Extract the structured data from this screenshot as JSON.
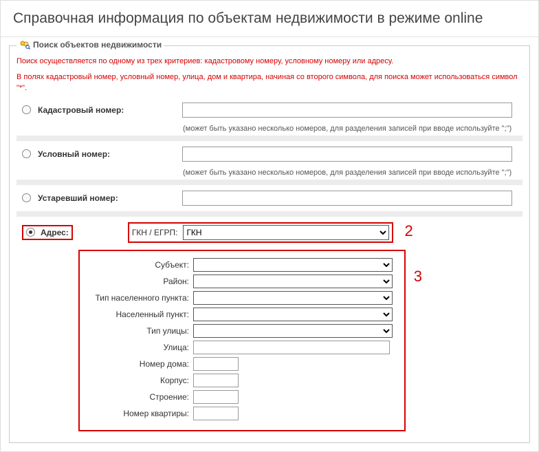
{
  "title": "Справочная информация по объектам недвижимости в режиме online",
  "panel": {
    "legend": "Поиск объектов недвижимости"
  },
  "info": {
    "line1": "Поиск осуществляется по одному из трех критериев: кадастровому номеру, условному номеру или адресу.",
    "line2": "В полях кадастровый номер, условный номер, улица, дом и квартира, начиная со второго символа, для поиска может использоваться символ \"*\"."
  },
  "criteria": {
    "cadastral": {
      "label": "Кадастровый номер:",
      "value": "",
      "hint": "(может быть указано несколько номеров, для разделения записей при вводе используйте \";\")"
    },
    "conditional": {
      "label": "Условный номер:",
      "value": "",
      "hint": "(может быть указано несколько номеров, для разделения записей при вводе используйте \";\")"
    },
    "obsolete": {
      "label": "Устаревший номер:",
      "value": ""
    },
    "address": {
      "label": "Адрес:",
      "source_label": "ГКН / ЕГРП:",
      "source_value": "ГКН",
      "fields": {
        "subject": {
          "label": "Субъект:"
        },
        "district": {
          "label": "Район:"
        },
        "settl_type": {
          "label": "Тип населенного пункта:"
        },
        "settlement": {
          "label": "Населенный пункт:"
        },
        "street_type": {
          "label": "Тип улицы:"
        },
        "street": {
          "label": "Улица:",
          "value": ""
        },
        "house": {
          "label": "Номер дома:",
          "value": ""
        },
        "building": {
          "label": "Корпус:",
          "value": ""
        },
        "structure": {
          "label": "Строение:",
          "value": ""
        },
        "apartment": {
          "label": "Номер квартиры:",
          "value": ""
        }
      }
    }
  },
  "annotations": {
    "two": "2",
    "three": "3"
  }
}
